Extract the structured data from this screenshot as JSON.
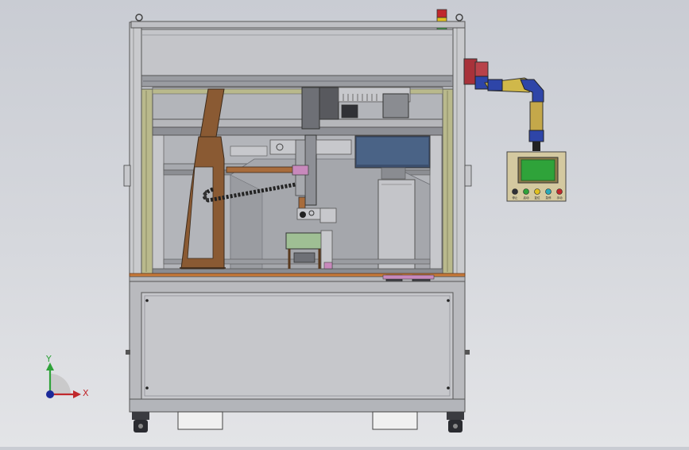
{
  "triad": {
    "x_label": "X",
    "y_label": "Y",
    "colors": {
      "x": "#c0282c",
      "y": "#2fa23a",
      "z": "#1c2a9a"
    }
  },
  "panel": {
    "button_labels": [
      "停止",
      "启动",
      "复位",
      "急停",
      "手动"
    ]
  },
  "colors": {
    "background": "#d4d6db",
    "frame": "#c9cacd",
    "frame_dark": "#6e7076",
    "wood": "#8a5a33",
    "olive": "#b9b98c",
    "screen": "#3c4f6e",
    "hmi_screen": "#2fa33a",
    "pipe_blue": "#2e45a8",
    "pipe_red": "#a8323a",
    "pink": "#c889bc"
  },
  "stack_light": [
    "#c0282c",
    "#e0c020",
    "#2fa23a"
  ]
}
